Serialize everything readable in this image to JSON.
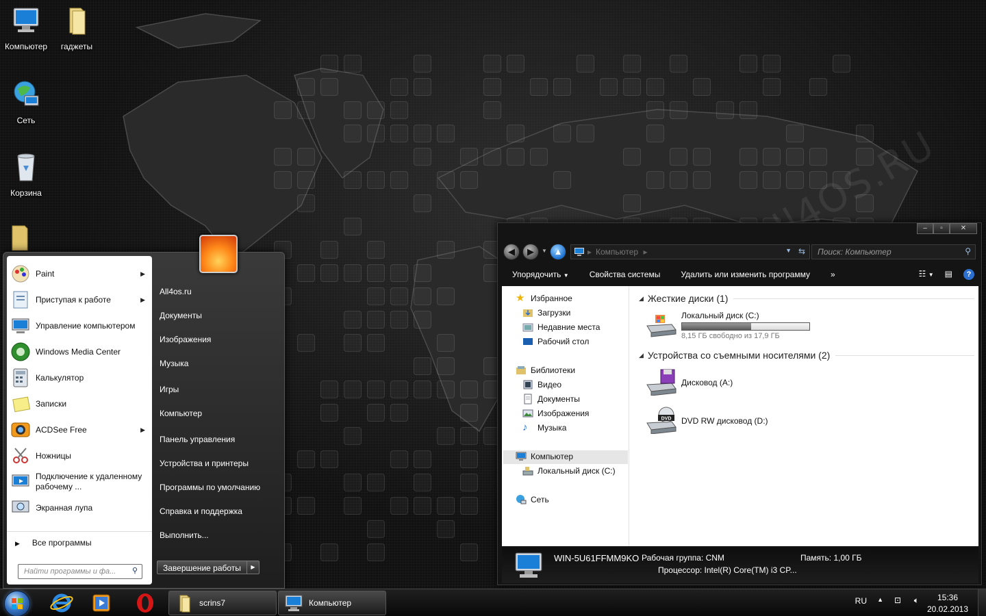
{
  "desktop": {
    "icons": [
      {
        "label": "Компьютер",
        "icon": "computer-icon"
      },
      {
        "label": "гаджеты",
        "icon": "folder-icon"
      },
      {
        "label": "Сеть",
        "icon": "network-globe-icon"
      },
      {
        "label": "Корзина",
        "icon": "recycle-bin-icon"
      }
    ],
    "watermark": "All4OS.RU"
  },
  "start_menu": {
    "programs": [
      {
        "label": "Paint",
        "has_arrow": true
      },
      {
        "label": "Приступая к работе",
        "has_arrow": true
      },
      {
        "label": "Управление компьютером",
        "has_arrow": false
      },
      {
        "label": "Windows Media Center",
        "has_arrow": false
      },
      {
        "label": "Калькулятор",
        "has_arrow": false
      },
      {
        "label": "Записки",
        "has_arrow": false
      },
      {
        "label": "ACDSee Free",
        "has_arrow": true
      },
      {
        "label": "Ножницы",
        "has_arrow": false
      },
      {
        "label": "Подключение к удаленному рабочему ...",
        "has_arrow": false
      },
      {
        "label": "Экранная лупа",
        "has_arrow": false
      }
    ],
    "all_programs": "Все программы",
    "search_placeholder": "Найти программы и фа...",
    "right_items": [
      "All4os.ru",
      "Документы",
      "Изображения",
      "Музыка",
      "Игры",
      "Компьютер",
      "Панель управления",
      "Устройства и принтеры",
      "Программы по умолчанию",
      "Справка и поддержка",
      "Выполнить..."
    ],
    "shutdown": "Завершение работы"
  },
  "explorer": {
    "address": "Компьютер",
    "search_placeholder": "Поиск: Компьютер",
    "toolbar": {
      "organize": "Упорядочить",
      "system_props": "Свойства системы",
      "uninstall": "Удалить или изменить программу",
      "more": "»"
    },
    "nav": {
      "favorites": "Избранное",
      "downloads": "Загрузки",
      "recent": "Недавние места",
      "desktop": "Рабочий стол",
      "libraries": "Библиотеки",
      "video": "Видео",
      "documents": "Документы",
      "images": "Изображения",
      "music": "Музыка",
      "computer": "Компьютер",
      "local_disk": "Локальный диск (C:)",
      "network": "Сеть"
    },
    "content": {
      "hdd_header": "Жесткие диски (1)",
      "disk_c_name": "Локальный диск (C:)",
      "disk_c_free": "8,15 ГБ свободно из 17,9 ГБ",
      "disk_c_used_fraction": 0.545,
      "removable_header": "Устройства со съемными носителями (2)",
      "floppy": "Дисковод (A:)",
      "dvd": "DVD RW дисковод (D:)"
    },
    "details": {
      "computer_name": "WIN-5U61FFMM9KO",
      "workgroup": "Рабочая группа: CNM",
      "memory": "Память: 1,00 ГБ",
      "cpu": "Процессор: Intel(R) Core(TM) i3 CP..."
    }
  },
  "taskbar": {
    "buttons": [
      {
        "label": "scrins7",
        "icon": "folder-icon"
      },
      {
        "label": "Компьютер",
        "icon": "computer-icon"
      }
    ],
    "lang": "RU",
    "time": "15:36",
    "date": "20.02.2013"
  },
  "colors": {
    "accent": "#1b6fd1",
    "dark_bg": "#111111",
    "pane_bg": "#ffffff"
  }
}
